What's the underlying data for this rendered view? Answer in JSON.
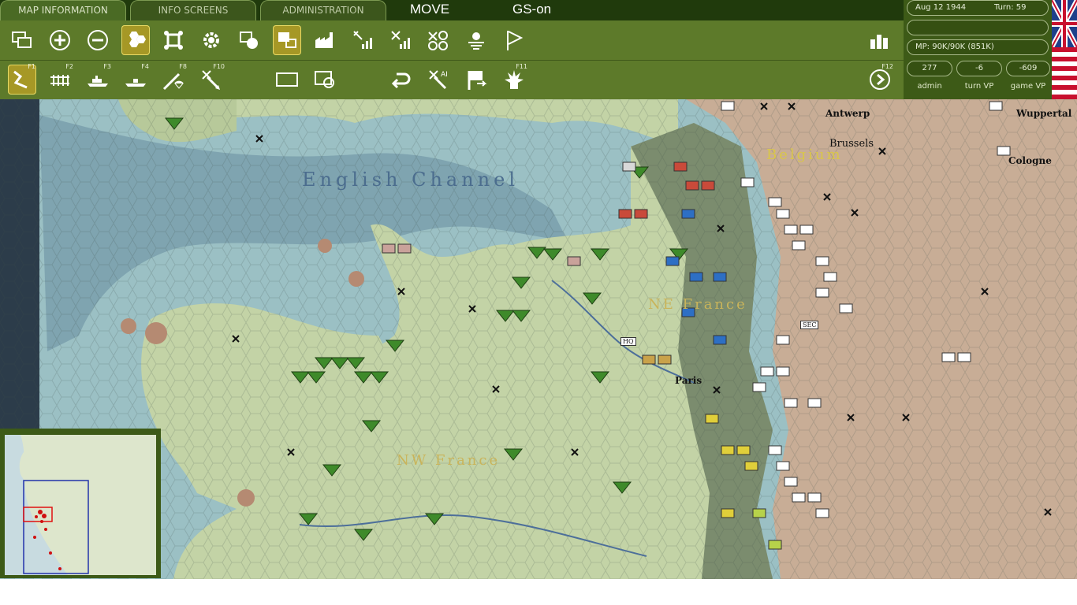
{
  "tabs": {
    "map_information": "MAP INFORMATION",
    "info_screens": "INFO SCREENS",
    "administration": "ADMINISTRATION",
    "mode": "MOVE",
    "gs_status": "GS-on"
  },
  "toolbar": {
    "row1_icons": [
      "windows-icon",
      "zoom-in-icon",
      "zoom-out-icon",
      "hex-grid-icon",
      "unit-frame-icon",
      "settings-gear-icon",
      "unit-circle-icon",
      "supply-overlay-icon",
      "production-icon",
      "air-strength-icon",
      "air-range-icon",
      "air-recon-icon",
      "weather-icon",
      "flag-icon"
    ],
    "row2_keys": [
      "F1",
      "F2",
      "F3",
      "F4",
      "F8",
      "F10",
      "F11",
      "F12"
    ],
    "ai_label": "AI"
  },
  "status": {
    "date": "Aug 12 1944",
    "turn_label": "Turn: 59",
    "mp": "MP: 90K/90K (851K)",
    "admin_value": "277",
    "turn_vp_value": "-6",
    "game_vp_value": "-609",
    "admin_label": "admin",
    "turn_vp_label": "turn VP",
    "game_vp_label": "game VP"
  },
  "map_labels": {
    "sea": "English Channel",
    "region_nw": "NW France",
    "region_ne": "NE France",
    "country": "Belgium",
    "city_antwerp": "Antwerp",
    "city_brussels": "Brussels",
    "city_cologne": "Cologne",
    "city_wuppertal": "Wuppertal",
    "city_paris": "Paris",
    "hq_label": "HQ",
    "sec_label": "SEC"
  },
  "colors": {
    "sea": "#9bc0c4",
    "deep_sea": "#7fa4b0",
    "allied_land": "#c3d3a6",
    "front_land": "#7b8c6e",
    "axis_land": "#c8ad96",
    "allied_unit": "#3e8a2a",
    "axis_unit": "#ffffff",
    "toolbar": "#5d7a2a"
  }
}
